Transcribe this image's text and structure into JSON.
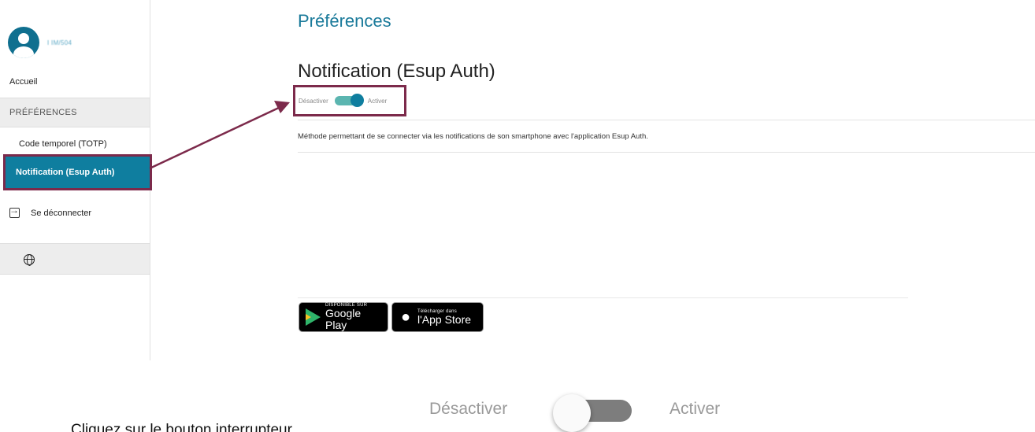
{
  "sidebar": {
    "user_name": "I IM/504",
    "home_label": "Accueil",
    "section_label": "PRÉFÉRENCES",
    "items": [
      {
        "label": "Code temporel (TOTP)"
      },
      {
        "label": "Notification (Esup Auth)"
      }
    ],
    "logout_label": "Se déconnecter"
  },
  "main": {
    "page_title": "Préférences",
    "section_title": "Notification (Esup Auth)",
    "toggle": {
      "off_label": "Désactiver",
      "on_label": "Activer",
      "state": "on"
    },
    "description": "Méthode permettant de se connecter via les notifications de son smartphone avec l'application Esup Auth."
  },
  "stores": {
    "google": {
      "small": "DISPONIBLE SUR",
      "big": "Google Play"
    },
    "apple": {
      "small": "Télécharger dans",
      "big": "l'App Store"
    }
  },
  "big_toggle": {
    "off_label": "Désactiver",
    "on_label": "Activer",
    "state": "off"
  },
  "caption": "Cliquez sur le bouton interrupteur",
  "colors": {
    "accent": "#0f7e9f",
    "highlight": "#7c2a4b",
    "toggle_on": "#5bb5b0"
  }
}
